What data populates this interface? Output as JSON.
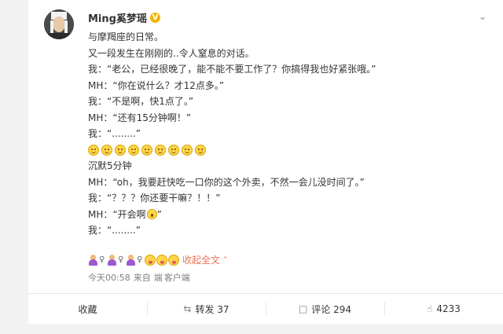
{
  "post": {
    "username": "Ming奚梦瑶",
    "verified_badge": "V",
    "lines": [
      "与摩羯座的日常。",
      "又一段发生在刚刚的..令人窒息的对话。",
      "我：“老公，已经很晚了，能不能不要工作了？你搞得我也好紧张哦。”",
      "MH：“你在说什么？才12点多。”",
      "我：“不是啊，快1点了。”",
      "MH：“还有15分钟啊！”",
      "我：“........”"
    ],
    "lines_after": [
      "沉默5分钟",
      "MH：“oh，我要赶快吃一口你的这个外卖，不然一会儿没时间了。”",
      "我：“？？？你还要干嘛？！！”"
    ],
    "meeting_line": "MH：“开会啊",
    "meeting_line_end": "”",
    "last_line": "我：“........”",
    "expand_label": "收起全文",
    "meta": {
      "time": "今天00:58",
      "from_label": "来自",
      "source_icon_text": "端",
      "client_label": "客户端"
    }
  },
  "actions": {
    "favorite": "收藏",
    "repost": "转发 37",
    "comment": "评论 294",
    "like": "4233"
  },
  "icons": {
    "more": "chevron-down-icon",
    "repost": "repost-icon",
    "comment": "comment-icon",
    "like": "thumbs-up-icon"
  }
}
